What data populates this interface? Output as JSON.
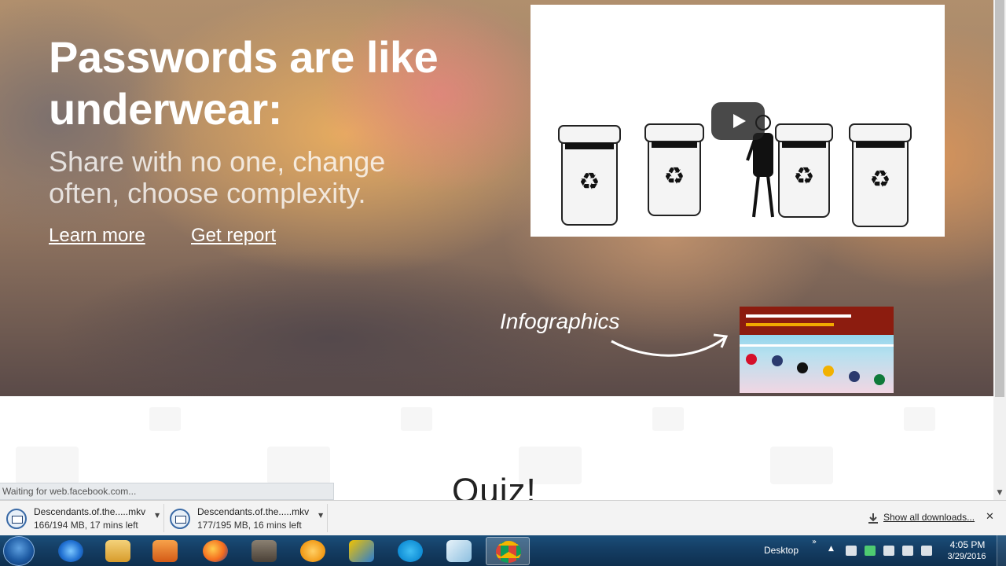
{
  "hero": {
    "headline": "Passwords are like underwear:",
    "subhead": "Share with no one, change often, choose complexity.",
    "learn_more": "Learn more",
    "get_report": "Get report",
    "infographics_label": "Infographics"
  },
  "quiz": {
    "title": "Quiz!"
  },
  "status_bar": {
    "text": "Waiting for web.facebook.com..."
  },
  "downloads": {
    "items": [
      {
        "name": "Descendants.of.the.....mkv",
        "progress": "166/194 MB, 17 mins left"
      },
      {
        "name": "Descendants.of.the.....mkv",
        "progress": "177/195 MB, 16 mins left"
      }
    ],
    "show_all": "Show all downloads..."
  },
  "taskbar": {
    "desktop_label": "Desktop",
    "time": "4:05 PM",
    "date": "3/29/2016",
    "pinned": [
      "internet-explorer",
      "file-explorer",
      "media-player",
      "firefox",
      "gimp",
      "orange-app",
      "security-app",
      "skype",
      "notes-app",
      "chrome"
    ]
  },
  "colors": {
    "accent": "#8c1c0f",
    "taskbar": "#153f66"
  }
}
